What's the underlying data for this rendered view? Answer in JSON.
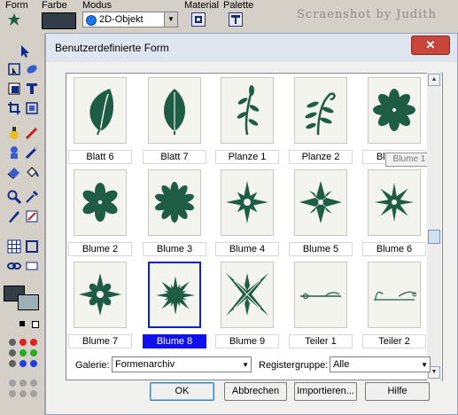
{
  "toolbar": {
    "form_label": "Form",
    "farbe_label": "Farbe",
    "modus_label": "Modus",
    "modus_value": "2D-Objekt",
    "material_label": "Material",
    "palette_label": "Palette",
    "farbe_color": "#333d47"
  },
  "watermark": "Scraenshot by Judith",
  "tools_icons": [
    "arrow-pointer-icon",
    "pick-tool-icon",
    "node-edit-icon",
    "text-tool-icon",
    "crop-icon",
    "deform-icon",
    "color-replacer-icon",
    "paint-brush-icon",
    "clone-brush-icon",
    "retouch-icon",
    "fill-icon",
    "eraser-icon",
    "zoom-icon",
    "eyedropper-icon",
    "pen-icon",
    "shape-icon",
    "grid-icon",
    "frame-icon",
    "link-icon",
    "fill-color-swatch",
    "stroke-color-swatch"
  ],
  "dialog": {
    "title": "Benutzerdefinierte Form",
    "close_icon": "close-icon",
    "tooltip": "Blume 1",
    "shapes": [
      {
        "label": "Blatt 6",
        "icon": "leaf-icon",
        "selected": false
      },
      {
        "label": "Blatt 7",
        "icon": "leaf-icon",
        "selected": false
      },
      {
        "label": "Planze 1",
        "icon": "plant-icon",
        "selected": false
      },
      {
        "label": "Planze 2",
        "icon": "fern-icon",
        "selected": false
      },
      {
        "label": "Blume 1",
        "icon": "flower-icon",
        "selected": false
      },
      {
        "label": "Blume 2",
        "icon": "flower-icon",
        "selected": false
      },
      {
        "label": "Blume 3",
        "icon": "flower-icon",
        "selected": false
      },
      {
        "label": "Blume 4",
        "icon": "flower-icon",
        "selected": false
      },
      {
        "label": "Blume 5",
        "icon": "flower-icon",
        "selected": false
      },
      {
        "label": "Blume 6",
        "icon": "flower-icon",
        "selected": false
      },
      {
        "label": "Blume 7",
        "icon": "flower-icon",
        "selected": false
      },
      {
        "label": "Blume 8",
        "icon": "flower-icon",
        "selected": true
      },
      {
        "label": "Blume 9",
        "icon": "flower-icon",
        "selected": false
      },
      {
        "label": "Teiler 1",
        "icon": "divider-icon",
        "selected": false
      },
      {
        "label": "Teiler 2",
        "icon": "divider-icon",
        "selected": false
      }
    ],
    "galerie_label": "Galerie:",
    "galerie_value": "Formenarchiv",
    "registergruppe_label": "Registergruppe:",
    "registergruppe_value": "Alle",
    "buttons": {
      "ok": "OK",
      "abbrechen": "Abbrechen",
      "importieren": "Importieren...",
      "hilfe": "Hilfe"
    },
    "shape_color": "#1e5c46",
    "selection_color": "#1010ee"
  }
}
